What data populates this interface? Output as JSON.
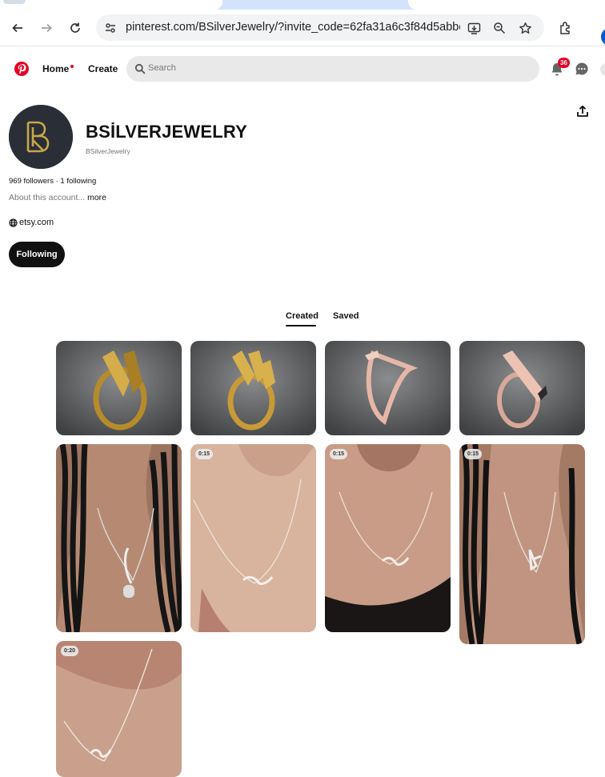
{
  "browser": {
    "url_host": "pinterest.com",
    "url_path": "/BSilverJewelry/?invite_code=62fa31a6c3f84d5abbe..."
  },
  "header": {
    "home_label": "Home",
    "create_label": "Create",
    "search_placeholder": "Search",
    "notification_count": "36"
  },
  "profile": {
    "name": "BSİLVERJEWELRY",
    "handle": "BSilverJewelry",
    "stats": "969 followers · 1 following",
    "about": "About this account...",
    "about_more": "more",
    "website": "etsy.com",
    "follow_button": "Following"
  },
  "tabs": {
    "created": "Created",
    "saved": "Saved"
  },
  "pins": [
    {
      "kind": "ring-gold"
    },
    {
      "kind": "ring-gold-initials"
    },
    {
      "kind": "ring-rose"
    },
    {
      "kind": "ring-rose-bar"
    },
    {
      "kind": "necklace-braids"
    },
    {
      "kind": "necklace-name",
      "duration": "0:15"
    },
    {
      "kind": "necklace-name",
      "duration": "0:15"
    },
    {
      "kind": "necklace-braids-initials",
      "duration": "0:15"
    },
    {
      "kind": "necklace-name-close",
      "duration": "0:20"
    }
  ]
}
